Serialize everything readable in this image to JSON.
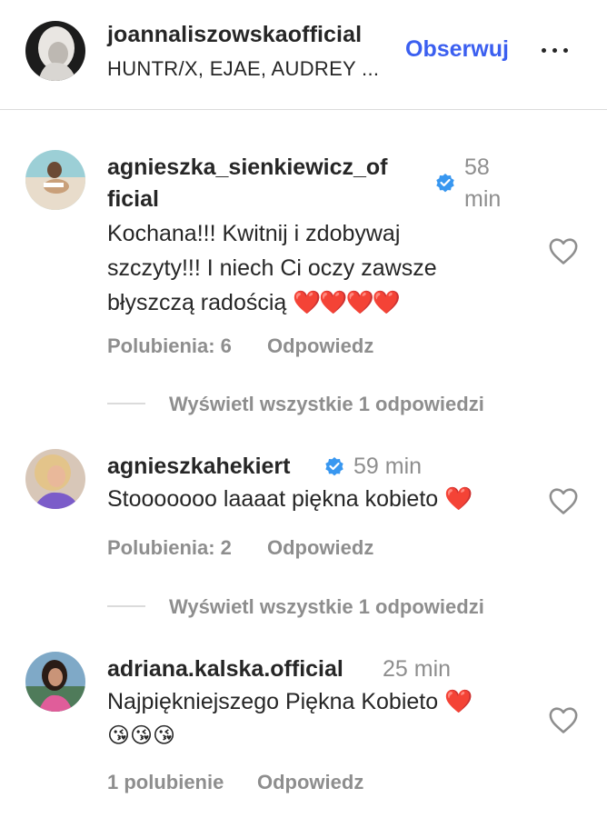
{
  "header": {
    "username": "joannaliszowskaofficial",
    "subtitle": "HUNTR/X, EJAE, AUDREY ...",
    "follow_label": "Obserwuj"
  },
  "comments": [
    {
      "username_line1": "agnieszka_sienkiewicz_of",
      "username_line2": "ficial",
      "verified": true,
      "time_line1": "58",
      "time_line2": "min",
      "text_line1": "Kochana!!! Kwitnij i zdobywaj",
      "text_line2": "szczyty!!! I niech Ci oczy zawsze",
      "text_line3": "błyszczą radością",
      "text_emoji": "❤️❤️❤️❤️",
      "likes": "Polubienia: 6",
      "reply": "Odpowiedz",
      "view_replies": "Wyświetl wszystkie 1 odpowiedzi"
    },
    {
      "username": "agnieszkahekiert",
      "verified": true,
      "time": "59 min",
      "text": "Stooooooo laaaat piękna kobieto",
      "text_emoji": "❤️",
      "likes": "Polubienia: 2",
      "reply": "Odpowiedz",
      "view_replies": "Wyświetl wszystkie 1 odpowiedzi"
    },
    {
      "username": "adriana.kalska.official",
      "verified": false,
      "time": "25 min",
      "text_line1": "Najpiękniejszego Piękna Kobieto",
      "text_emoji": "❤️",
      "text_line2_emoji": "😘😘😘",
      "likes": "1 polubienie",
      "reply": "Odpowiedz"
    }
  ],
  "colors": {
    "follow_blue": "#3b5ff0",
    "verified_blue": "#3897f0",
    "muted_gray": "#8e8e8e",
    "heart_red": "#d91f26",
    "divider": "#dbdbdb"
  },
  "icons": [
    "avatar",
    "verified-badge-icon",
    "heart-outline-icon",
    "more-options-icon"
  ]
}
